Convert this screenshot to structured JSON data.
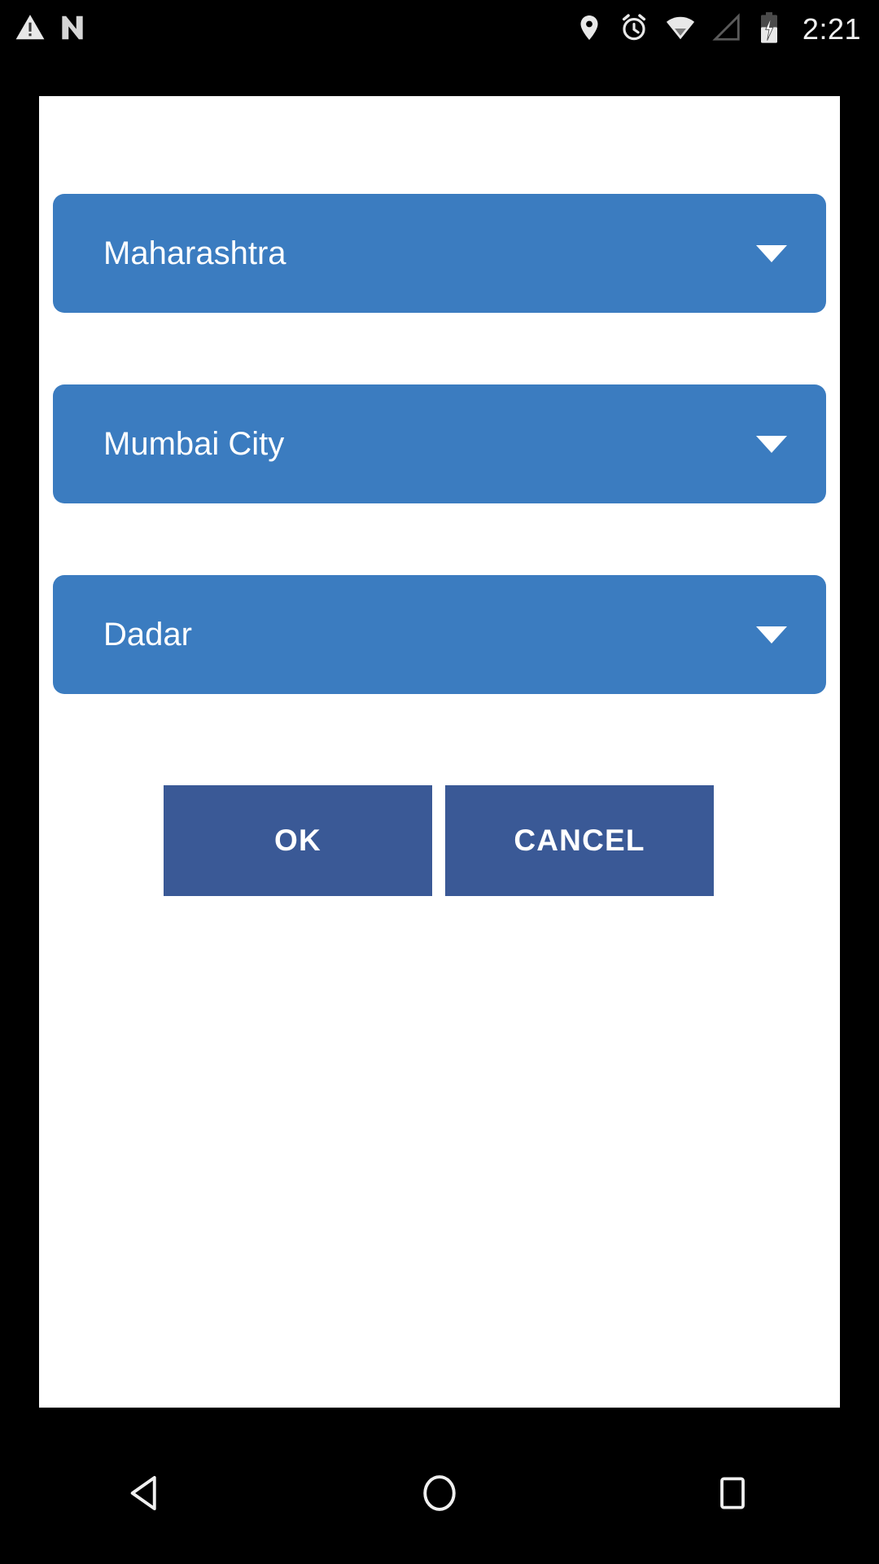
{
  "status_bar": {
    "left_icons": [
      {
        "name": "warning-triangle-icon",
        "glyph": "warning"
      },
      {
        "name": "nexus-n-icon",
        "glyph": "n-logo"
      }
    ],
    "right_icons": [
      {
        "name": "location-pin-icon",
        "glyph": "location"
      },
      {
        "name": "alarm-clock-icon",
        "glyph": "alarm"
      },
      {
        "name": "wifi-icon",
        "glyph": "wifi"
      },
      {
        "name": "cellular-signal-icon",
        "glyph": "signal-none"
      },
      {
        "name": "battery-charging-icon",
        "glyph": "battery-charging"
      }
    ],
    "time": "2:21"
  },
  "dialog": {
    "spinners": [
      {
        "name": "state-spinner",
        "value": "Maharashtra",
        "icon": "chevron-down-icon"
      },
      {
        "name": "district-spinner",
        "value": "Mumbai City",
        "icon": "chevron-down-icon"
      },
      {
        "name": "area-spinner",
        "value": "Dadar",
        "icon": "chevron-down-icon"
      }
    ],
    "buttons": {
      "ok_label": "OK",
      "cancel_label": "CANCEL"
    }
  },
  "nav_bar": {
    "back_label": "Back",
    "home_label": "Home",
    "recents_label": "Recent apps"
  },
  "colors": {
    "spinner_blue": "#3b7cc0",
    "button_blue": "#3a5996",
    "card_background": "#ffffff",
    "system_background": "#000000",
    "text_on_blue": "#ffffff",
    "status_icon": "#e8e8e8"
  }
}
